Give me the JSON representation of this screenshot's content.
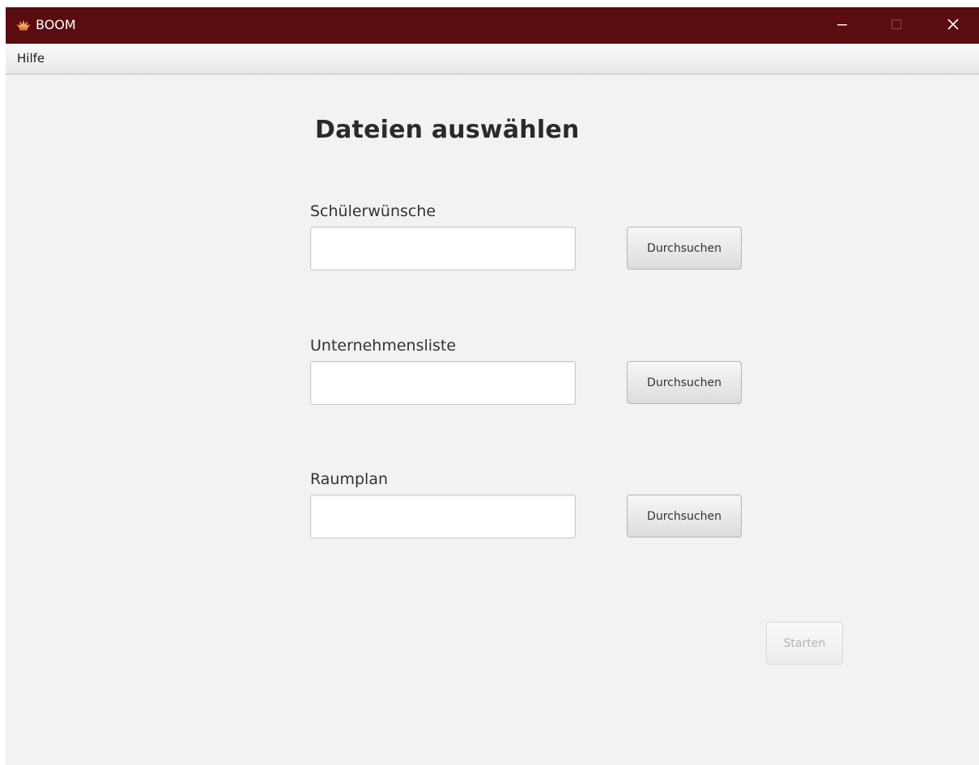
{
  "window": {
    "title": "BOOM",
    "icon": "flame-icon",
    "controls": {
      "minimize": "minimize-icon",
      "maximize": "maximize-icon",
      "close": "close-icon"
    }
  },
  "menubar": {
    "items": [
      {
        "label": "Hilfe"
      }
    ]
  },
  "main": {
    "heading": "Dateien auswählen",
    "fields": [
      {
        "label": "Schülerwünsche",
        "value": "",
        "button_label": "Durchsuchen"
      },
      {
        "label": "Unternehmensliste",
        "value": "",
        "button_label": "Durchsuchen"
      },
      {
        "label": "Raumplan",
        "value": "",
        "button_label": "Durchsuchen"
      }
    ],
    "start_button": {
      "label": "Starten",
      "enabled": false
    }
  },
  "colors": {
    "titlebar": "#5a0c0f",
    "background": "#f2f2f2",
    "disabled_text": "#b5b5b5"
  }
}
